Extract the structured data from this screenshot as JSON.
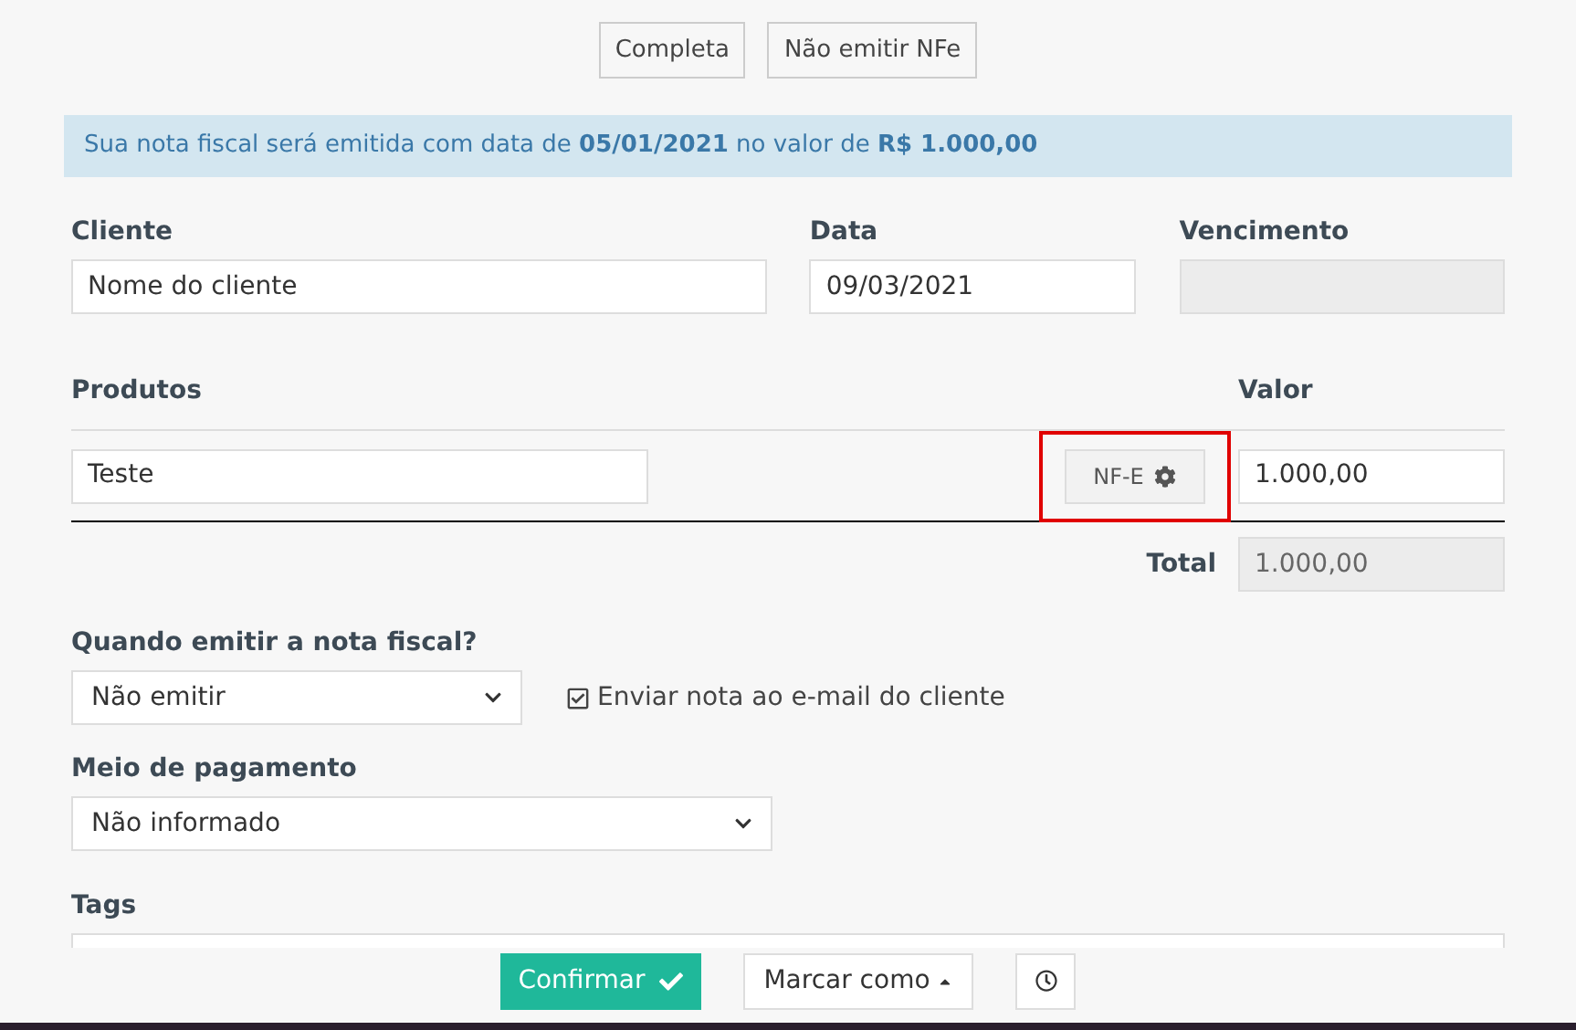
{
  "top_buttons": [
    {
      "label": "Completa",
      "selected": false
    },
    {
      "label": "Não emitir NFe",
      "selected": false
    }
  ],
  "alert": "Sua nota fiscal será emitida com data de **05/01/2021** no valor de **R$ 1.000,00**",
  "cliente": {
    "label": "Cliente",
    "value": "Nome do cliente"
  },
  "data": {
    "label": "Data",
    "value": "09/03/2021"
  },
  "vencimento": {
    "label": "Vencimento",
    "disabled": true
  },
  "produtos": {
    "label": "Produtos",
    "valor_label": "Valor",
    "items": [
      {
        "name": "Teste",
        "badge": "NF-E",
        "value": "1.000,00",
        "highlighted": true
      }
    ],
    "total_label": "Total",
    "total": "1.000,00"
  },
  "quando": {
    "label": "Quando emitir a nota fiscal?",
    "value": "Não emitir"
  },
  "enviar": {
    "label": "Enviar nota ao e-mail do cliente",
    "checked": true
  },
  "meio": {
    "label": "Meio de pagamento",
    "value": "Não informado"
  },
  "tags": {
    "label": "Tags"
  },
  "footer": {
    "confirm": "Confirmar",
    "mark": "Marcar como"
  }
}
